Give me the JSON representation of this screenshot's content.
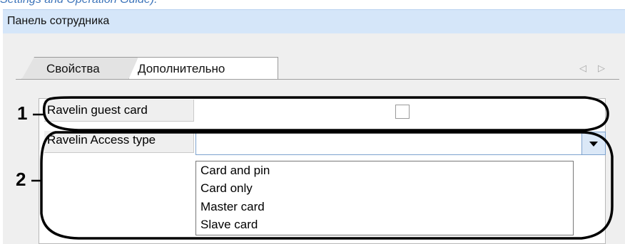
{
  "caption_fragment": "Settings and Operation Guide).",
  "window_title": "Панель сотрудника",
  "tabs": [
    {
      "label": "Свойства",
      "active": false
    },
    {
      "label": "Дополнительно",
      "active": true
    }
  ],
  "nav_icons": {
    "prev": "triangle-left-icon",
    "next": "triangle-right-icon"
  },
  "properties": {
    "guest_card_label": "Ravelin guest card",
    "guest_card_checked": false,
    "access_type_label": "Ravelin Access type",
    "access_type_value": ""
  },
  "access_type_options": [
    "Card and pin",
    "Card only",
    "Master card",
    "Slave card"
  ],
  "callouts": [
    "1",
    "2"
  ],
  "colors": {
    "title_bar": "#d5e6f9",
    "panel": "#efefef",
    "caption_link": "#3b73b9",
    "dropdown_button": "#dbe8f7"
  }
}
